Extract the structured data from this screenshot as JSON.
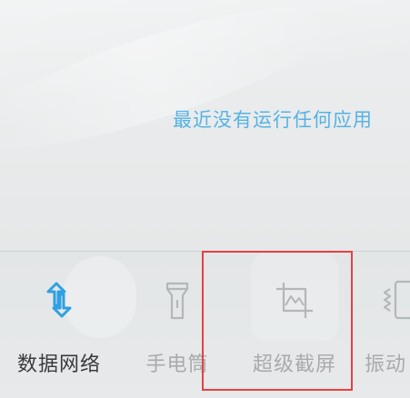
{
  "recent_apps": {
    "empty_message": "最近没有运行任何应用"
  },
  "quick_settings": {
    "tiles": [
      {
        "label": "数据网络",
        "icon": "data-network-icon",
        "active": true,
        "color": "#2fa0e2"
      },
      {
        "label": "手电筒",
        "icon": "flashlight-icon",
        "active": false
      },
      {
        "label": "超级截屏",
        "icon": "screenshot-icon",
        "active": false
      },
      {
        "label": "振动",
        "icon": "vibrate-icon",
        "active": false
      }
    ]
  },
  "colors": {
    "message": "#55b3e3",
    "active_icon": "#2fa0e2",
    "inactive": "#a8abad",
    "highlight": "#e84040"
  }
}
